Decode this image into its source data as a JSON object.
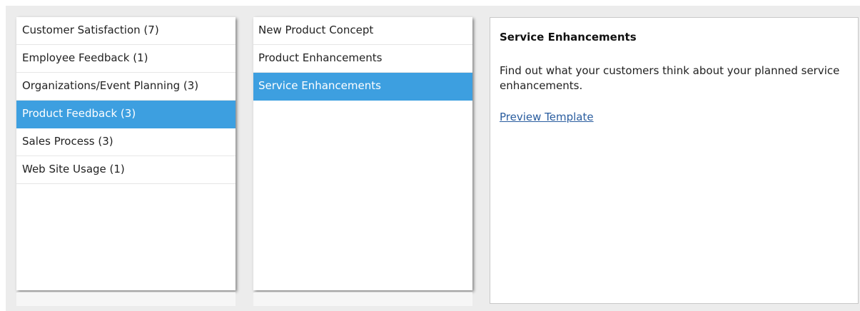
{
  "categories": {
    "items": [
      {
        "label": "Customer Satisfaction (7)",
        "selected": false
      },
      {
        "label": "Employee Feedback (1)",
        "selected": false
      },
      {
        "label": "Organizations/Event Planning (3)",
        "selected": false
      },
      {
        "label": "Product Feedback (3)",
        "selected": true
      },
      {
        "label": "Sales Process (3)",
        "selected": false
      },
      {
        "label": "Web Site Usage (1)",
        "selected": false
      }
    ]
  },
  "templates": {
    "items": [
      {
        "label": "New Product Concept",
        "selected": false
      },
      {
        "label": "Product Enhancements",
        "selected": false
      },
      {
        "label": "Service Enhancements",
        "selected": true
      }
    ]
  },
  "detail": {
    "title": "Service Enhancements",
    "description": "Find out what your customers think about your planned service enhancements.",
    "preview_link": "Preview Template"
  },
  "colors": {
    "selection": "#3d9fe0",
    "link": "#2a5d9f",
    "frame_background": "#ececec"
  }
}
